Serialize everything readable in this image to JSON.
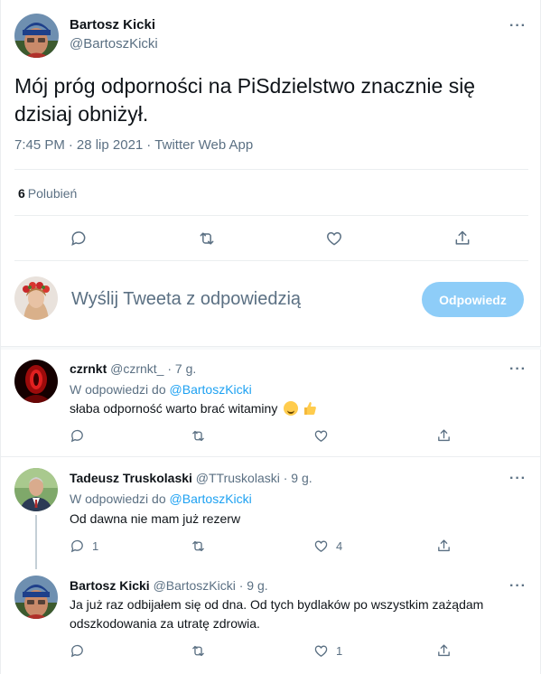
{
  "main_tweet": {
    "author_name": "Bartosz Kicki",
    "author_handle": "@BartoszKicki",
    "more_label": "···",
    "text": "Mój próg odporności na PiSdzielstwo znacznie się dzisiaj obniżył.",
    "time": "7:45 PM",
    "date": "28 lip 2021",
    "source": "Twitter Web App",
    "meta_separator": "·",
    "likes_count": "6",
    "likes_label": "Polubień"
  },
  "reply_composer": {
    "placeholder": "Wyślij Tweeta z odpowiedzią",
    "button_label": "Odpowiedz"
  },
  "replies": [
    {
      "name": "czrnkt",
      "handle": "@czrnkt_",
      "age": "· 7 g.",
      "reply_prefix": "W odpowiedzi do",
      "reply_to": "@BartoszKicki",
      "text": "słaba odporność warto brać witaminy",
      "reply_count": "",
      "like_count": ""
    },
    {
      "name": "Tadeusz Truskolaski",
      "handle": "@TTruskolaski",
      "age": "· 9 g.",
      "reply_prefix": "W odpowiedzi do",
      "reply_to": "@BartoszKicki",
      "text": "Od dawna nie mam już rezerw",
      "reply_count": "1",
      "like_count": "4"
    },
    {
      "name": "Bartosz Kicki",
      "handle": "@BartoszKicki",
      "age": "· 9 g.",
      "text": "Ja już raz odbijałem się od dna. Od tych bydlaków po wszystkim zażądam odszkodowania za utratę zdrowia.",
      "reply_count": "",
      "like_count": "1"
    }
  ],
  "colors": {
    "accent": "#1da1f2",
    "button_disabled": "#8ecdf8",
    "secondary_text": "#5b7083",
    "divider": "#ebeef0"
  },
  "icons": [
    "more-icon",
    "reply-icon",
    "retweet-icon",
    "like-icon",
    "share-icon"
  ]
}
